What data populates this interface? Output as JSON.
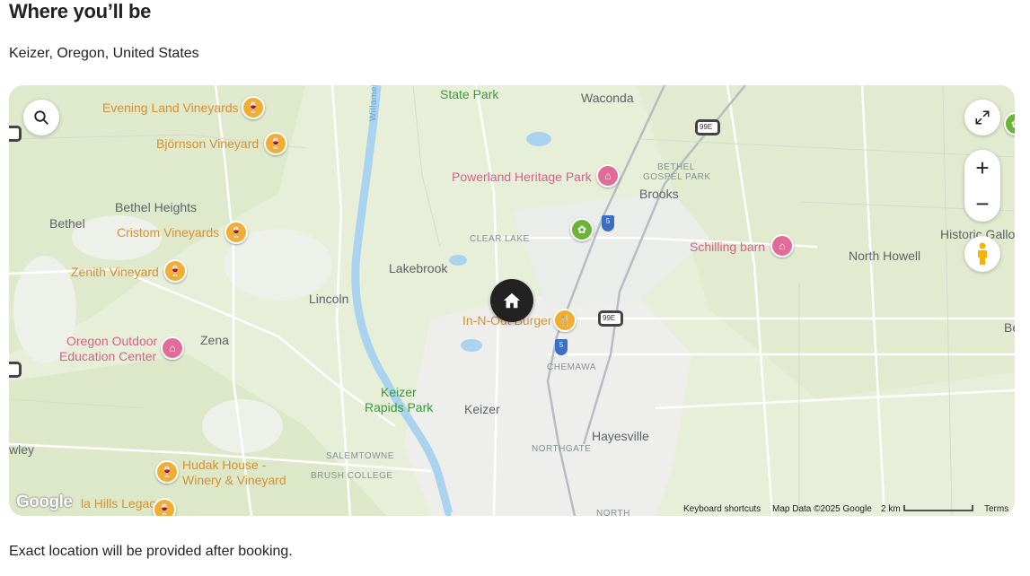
{
  "header": {
    "title": "Where you’ll be",
    "location": "Keizer, Oregon, United States"
  },
  "footer": {
    "note": "Exact location will be provided after booking."
  },
  "map": {
    "places": {
      "state_park": "State Park",
      "waconda": "Waconda",
      "evening_land": "Evening Land Vineyards",
      "bjornson": "Björnson Vineyard",
      "powerland": "Powerland Heritage Park",
      "bethel_gospel_1": "BETHEL",
      "bethel_gospel_2": "GOSPEL PARK",
      "brooks": "Brooks",
      "bethel_heights": "Bethel Heights",
      "bethel": "Bethel",
      "cristom": "Cristom Vineyards",
      "clear_lake": "CLEAR LAKE",
      "schilling": "Schilling barn",
      "historic_gallo": "Historic Gallo",
      "north_howell": "North Howell",
      "zenith": "Zenith Vineyard",
      "lakebrook": "Lakebrook",
      "lincoln": "Lincoln",
      "in_n_out": "In-N-Out Burger",
      "oregon_outdoor_1": "Oregon Outdoor",
      "oregon_outdoor_2": "Education Center",
      "zena": "Zena",
      "chemawa": "CHEMAWA",
      "keizer_rapids_1": "Keizer",
      "keizer_rapids_2": "Rapids Park",
      "keizer": "Keizer",
      "hayesville": "Hayesville",
      "northgate": "NORTHGATE",
      "wley": "wley",
      "salemtowne": "SALEMTOWNE",
      "brush_college": "BRUSH COLLEGE",
      "hudak_1": "Hudak House -",
      "hudak_2": "Winery & Vineyard",
      "legacy": "la Hills Legacy",
      "north": "NORTH",
      "be": "Be",
      "willamette": "Willamette River"
    },
    "routes": {
      "i5": "5",
      "us99e": "99E"
    },
    "attribution": {
      "logo": "Google",
      "shortcuts": "Keyboard shortcuts",
      "data": "Map Data ©2025 Google",
      "scale": "2 km",
      "terms": "Terms"
    },
    "controls": {
      "zoom_in": "+",
      "zoom_out": "−"
    },
    "colors": {
      "land": "#e8efd9",
      "urban": "#eeeeec",
      "water": "#a9d3ee",
      "winery_pin": "#f0ae32",
      "museum_pin": "#e06c97",
      "park_pin": "#6cb33a",
      "home_marker": "#222222"
    },
    "icons": [
      "search-icon",
      "expand-icon",
      "street-view-icon",
      "home-icon",
      "wine-icon",
      "museum-icon",
      "food-icon",
      "park-icon"
    ]
  }
}
